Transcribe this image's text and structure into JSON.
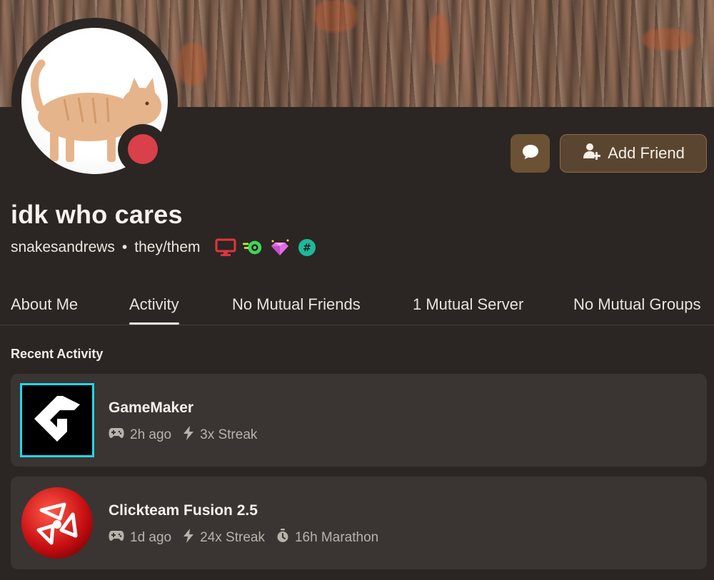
{
  "profile": {
    "display_name": "idk who cares",
    "username": "snakesandrews",
    "separator": "•",
    "pronouns": "they/them",
    "status_color": "#d9404a",
    "badges": [
      "monitor-icon",
      "nitro-icon",
      "gem-icon",
      "hashtag-icon"
    ]
  },
  "actions": {
    "message_icon": "chat-bubble-icon",
    "add_friend_label": "Add Friend"
  },
  "tabs": [
    {
      "label": "About Me",
      "active": false
    },
    {
      "label": "Activity",
      "active": true
    },
    {
      "label": "No Mutual Friends",
      "active": false
    },
    {
      "label": "1 Mutual Server",
      "active": false
    },
    {
      "label": "No Mutual Groups",
      "active": false
    }
  ],
  "recent_activity": {
    "title": "Recent Activity",
    "items": [
      {
        "name": "GameMaker",
        "icon": "gamemaker-logo",
        "time": "2h ago",
        "streak": "3x Streak"
      },
      {
        "name": "Clickteam Fusion 2.5",
        "icon": "clickteam-logo",
        "time": "1d ago",
        "streak": "24x Streak",
        "marathon": "16h Marathon"
      }
    ]
  },
  "colors": {
    "background": "#2b2623",
    "card": "#3a3532",
    "accent_button": "#5a4530",
    "message_button": "#6b5235"
  }
}
